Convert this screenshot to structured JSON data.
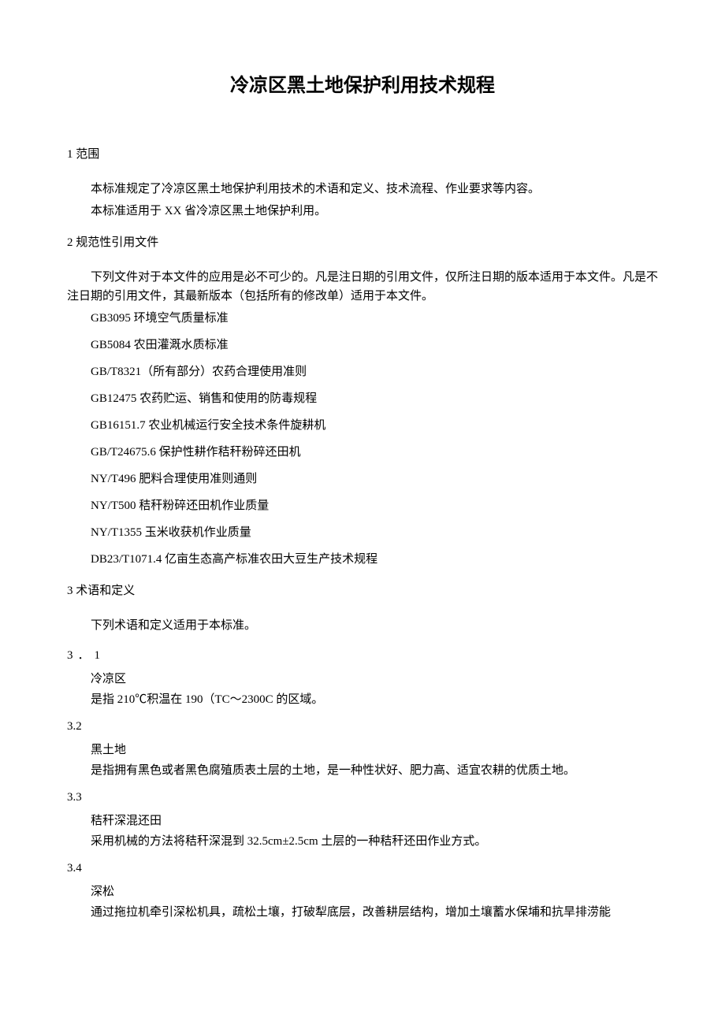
{
  "title": "冷凉区黑土地保护利用技术规程",
  "sections": {
    "s1": {
      "heading": "1 范围",
      "p1": "本标准规定了冷凉区黑土地保护利用技术的术语和定义、技术流程、作业要求等内容。",
      "p2": "本标准适用于 XX 省冷凉区黑土地保护利用。"
    },
    "s2": {
      "heading": "2 规范性引用文件",
      "intro": "下列文件对于本文件的应用是必不可少的。凡是注日期的引用文件，仅所注日期的版本适用于本文件。凡是不注日期的引用文件，其最新版本（包括所有的修改单）适用于本文件。",
      "refs": [
        "GB3095 环境空气质量标准",
        "GB5084 农田灌溉水质标准",
        "GB/T8321（所有部分）农药合理使用准则",
        "GB12475 农药贮运、销售和使用的防毒规程",
        "GB16151.7 农业机械运行安全技术条件旋耕机",
        "GB/T24675.6 保护性耕作秸秆粉碎还田机",
        "NY/T496 肥料合理使用准则通则",
        "NY/T500 秸秆粉碎还田机作业质量",
        "NY/T1355 玉米收获机作业质量",
        "DB23/T1071.4 亿亩生态高产标准农田大豆生产技术规程"
      ]
    },
    "s3": {
      "heading": "3 术语和定义",
      "intro": "下列术语和定义适用于本标准。",
      "terms": [
        {
          "num": "3．1",
          "name": "冷凉区",
          "desc": "是指 210℃积温在 190（TC〜2300C 的区域。"
        },
        {
          "num": "3.2",
          "name": "黑土地",
          "desc": "是指拥有黑色或者黑色腐殖质表土层的土地，是一种性状好、肥力高、适宜农耕的优质土地。"
        },
        {
          "num": "3.3",
          "name": "秸秆深混还田",
          "desc": "采用机械的方法将秸秆深混到 32.5cm±2.5cm 土层的一种秸秆还田作业方式。"
        },
        {
          "num": "3.4",
          "name": "深松",
          "desc": "通过拖拉机牵引深松机具，疏松土壤，打破犁底层，改善耕层结构，增加土壤蓄水保埔和抗旱排涝能"
        }
      ]
    }
  }
}
